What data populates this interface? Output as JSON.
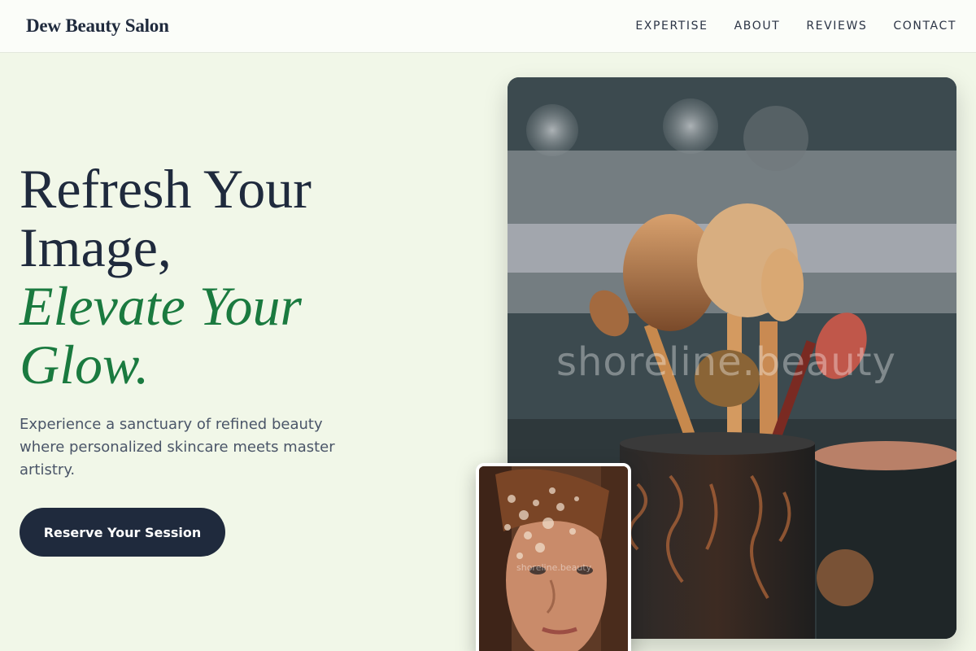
{
  "header": {
    "brand": "Dew Beauty Salon",
    "nav": [
      "EXPERTISE",
      "ABOUT",
      "REVIEWS",
      "CONTACT"
    ]
  },
  "hero": {
    "title_line1": "Refresh Your",
    "title_line2": "Image,",
    "accent_line1": "Elevate Your",
    "accent_line2": "Glow.",
    "subtitle": "Experience a sanctuary of refined beauty where personalized skincare meets master artistry.",
    "cta_label": "Reserve Your Session"
  },
  "images": {
    "main_watermark": "shoreline.beauty",
    "portrait_watermark": "shoreline.beauty"
  },
  "colors": {
    "background": "#f1f7e8",
    "navy": "#1f2a3d",
    "accent_green": "#1a7a3f"
  }
}
